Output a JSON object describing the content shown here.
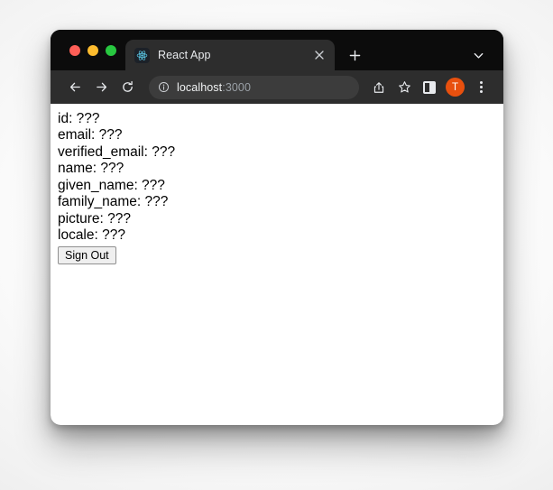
{
  "window": {
    "traffic_lights": [
      {
        "name": "close",
        "color": "#ff5f57"
      },
      {
        "name": "minimize",
        "color": "#febc2e"
      },
      {
        "name": "maximize",
        "color": "#28c840"
      }
    ]
  },
  "tab_strip": {
    "tabs": [
      {
        "title": "React App",
        "favicon": "react-logo-icon",
        "close_label": "×",
        "active": true
      }
    ],
    "new_tab_label": "+",
    "tab_search_icon": "chevron-down-icon"
  },
  "toolbar": {
    "back_icon": "back-arrow-icon",
    "forward_icon": "forward-arrow-icon",
    "reload_icon": "reload-icon",
    "omnibox": {
      "site_info_icon": "info-circle-icon",
      "host": "localhost",
      "port": ":3000",
      "full_url": "localhost:3000"
    },
    "share_icon": "share-icon",
    "bookmark_icon": "star-icon",
    "side_panel_icon": "side-panel-icon",
    "avatar_initial": "T",
    "avatar_color": "#e8500e",
    "menu_icon": "three-dot-menu-icon"
  },
  "page": {
    "profile_fields": [
      "id: ???",
      "email: ???",
      "verified_email: ???",
      "name: ???",
      "given_name: ???",
      "family_name: ???",
      "picture: ???",
      "locale: ???"
    ],
    "sign_out_label": "Sign Out"
  }
}
